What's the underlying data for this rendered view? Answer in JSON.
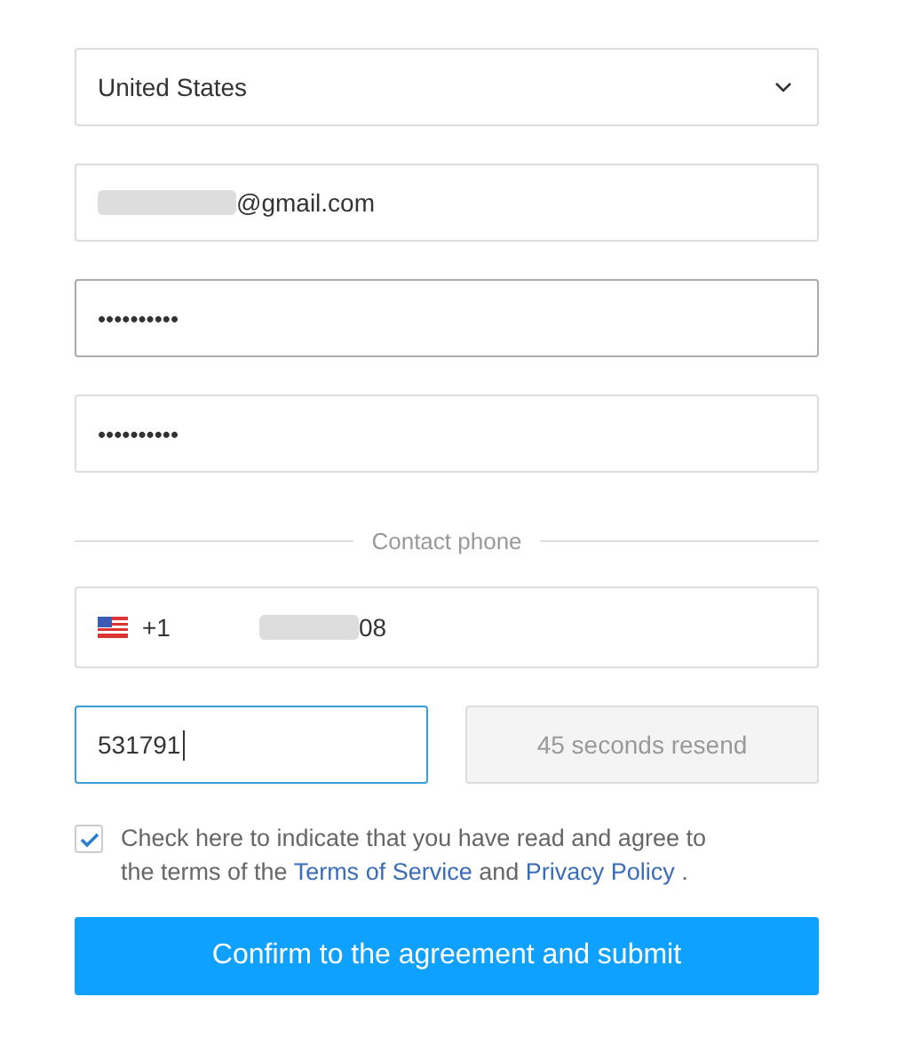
{
  "country_select": {
    "value": "United States"
  },
  "email": {
    "value": "@gmail.com",
    "redacted": true
  },
  "password": {
    "value": "••••••••••",
    "focused": true
  },
  "confirm_password": {
    "value": "••••••••••",
    "focused": false
  },
  "divider": {
    "label": "Contact phone"
  },
  "phone": {
    "code": "+1",
    "value": "08",
    "redacted": true
  },
  "verification_code": {
    "value": "531791",
    "focused": true
  },
  "resend_button": {
    "label": "45 seconds resend",
    "disabled": true
  },
  "agreement": {
    "checked": true,
    "text": "Check here to indicate that you have read and agree to the terms of the",
    "links": [
      "Terms of Service",
      "Privacy Policy"
    ],
    "joiner": "and",
    "end": "."
  },
  "submit_button": {
    "label": "Confirm to the agreement and submit"
  }
}
